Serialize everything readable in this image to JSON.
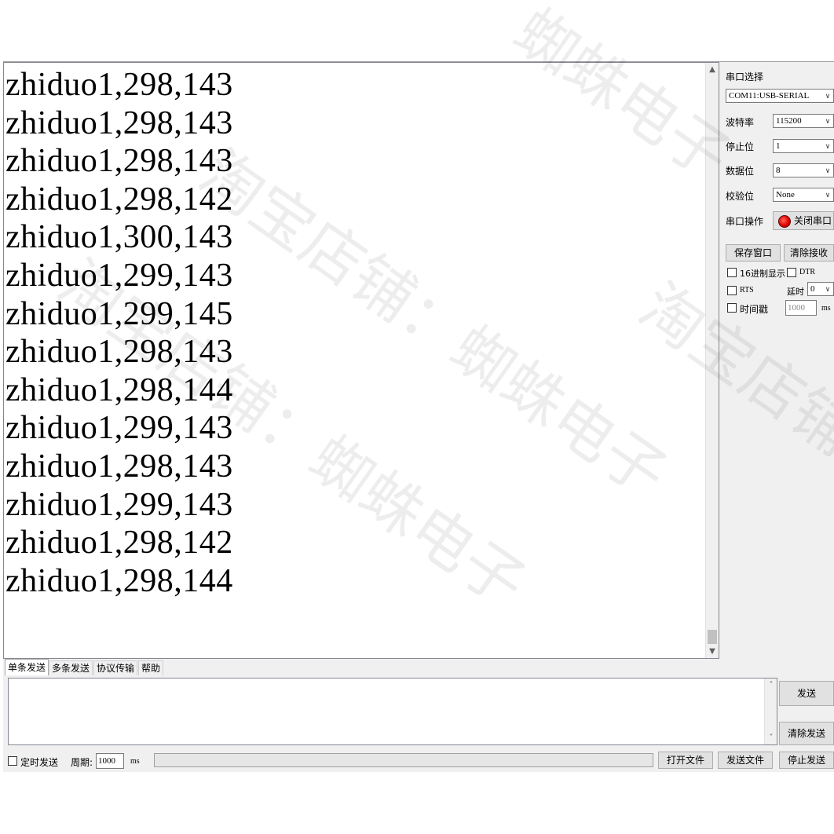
{
  "receive": {
    "lines": [
      "zhiduo1,298,143",
      "zhiduo1,298,143",
      "zhiduo1,298,143",
      "zhiduo1,298,142",
      "zhiduo1,300,143",
      "zhiduo1,299,143",
      "zhiduo1,299,145",
      "zhiduo1,298,143",
      "zhiduo1,298,144",
      "zhiduo1,299,143",
      "zhiduo1,298,143",
      "zhiduo1,299,143",
      "zhiduo1,298,142",
      "zhiduo1,298,144"
    ]
  },
  "panel": {
    "port_select_label": "串口选择",
    "port_value": "COM11:USB-SERIAL",
    "baud_label": "波特率",
    "baud_value": "115200",
    "stop_label": "停止位",
    "stop_value": "1",
    "data_label": "数据位",
    "data_value": "8",
    "parity_label": "校验位",
    "parity_value": "None",
    "op_label": "串口操作",
    "close_port_label": "关闭串口",
    "save_window_label": "保存窗口",
    "clear_recv_label": "清除接收",
    "hex_display_label": "16进制显示",
    "dtr_label": "DTR",
    "rts_label": "RTS",
    "delay_label": "延时",
    "delay_value": "0",
    "timestamp_label": "时间戳",
    "timestamp_value": "1000",
    "ms_label": "ms"
  },
  "tabs": [
    "单条发送",
    "多条发送",
    "协议传输",
    "帮助"
  ],
  "send": {
    "send_label": "发送",
    "clear_send_label": "清除发送"
  },
  "bottom": {
    "timed_send_label": "定时发送",
    "period_label": "周期:",
    "period_value": "1000",
    "ms_label": "ms",
    "open_file_label": "打开文件",
    "send_file_label": "发送文件",
    "stop_send_label": "停止发送"
  },
  "watermarks": [
    "淘宝店铺：蜘蛛电子",
    "淘宝店铺：蜘蛛电子",
    "淘宝店铺：蜘蛛电子",
    "蜘蛛电子"
  ]
}
